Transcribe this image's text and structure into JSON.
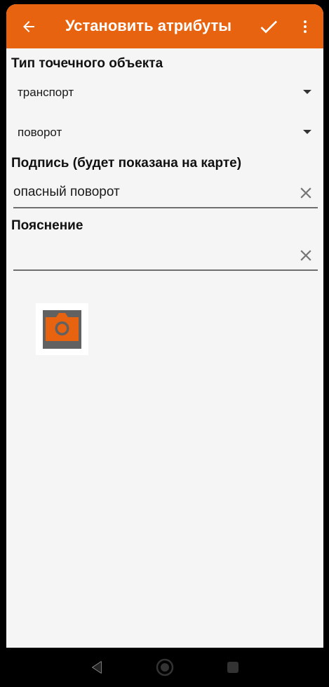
{
  "colors": {
    "accent": "#e8630f",
    "background": "#f5f5f5",
    "camera_body": "#616161"
  },
  "appbar": {
    "title": "Установить атрибуты",
    "back_icon": "arrow-back-icon",
    "confirm_icon": "check-icon",
    "menu_icon": "more-vert-icon"
  },
  "point_type": {
    "label": "Тип точечного объекта",
    "category_value": "транспорт",
    "subtype_value": "поворот"
  },
  "caption": {
    "label": "Подпись (будет показана на карте)",
    "value": "опасный поворот"
  },
  "note": {
    "label": "Пояснение",
    "value": ""
  },
  "photo": {
    "icon": "camera-icon"
  },
  "system_nav": {
    "back_icon": "nav-back-icon",
    "home_icon": "nav-home-icon",
    "recents_icon": "nav-recents-icon"
  }
}
